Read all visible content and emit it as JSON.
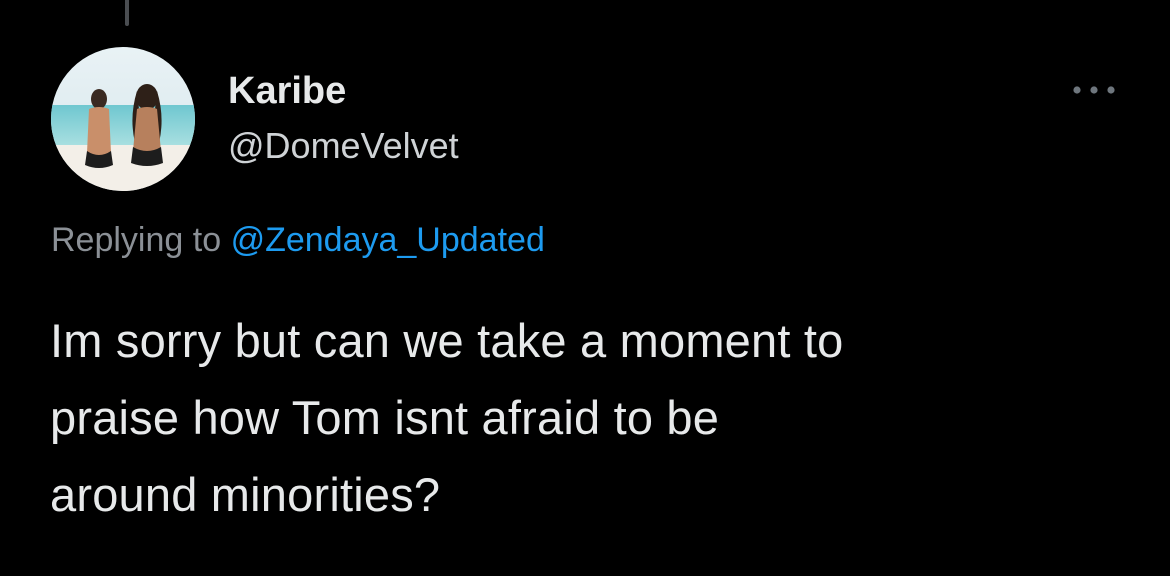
{
  "tweet": {
    "author": {
      "display_name": "Karibe",
      "handle": "@DomeVelvet"
    },
    "reply": {
      "prefix": "Replying to",
      "mention": "@Zendaya_Updated"
    },
    "lines": [
      "Im sorry but can we take a moment to",
      "praise how Tom isnt afraid to be",
      "around minorities?"
    ]
  },
  "colors": {
    "background": "#000000",
    "text": "#e7e9ea",
    "secondary": "#8b9096",
    "link": "#1d9bf0"
  },
  "icons": {
    "more": "more-dots-icon",
    "avatar": "beach-photo"
  }
}
